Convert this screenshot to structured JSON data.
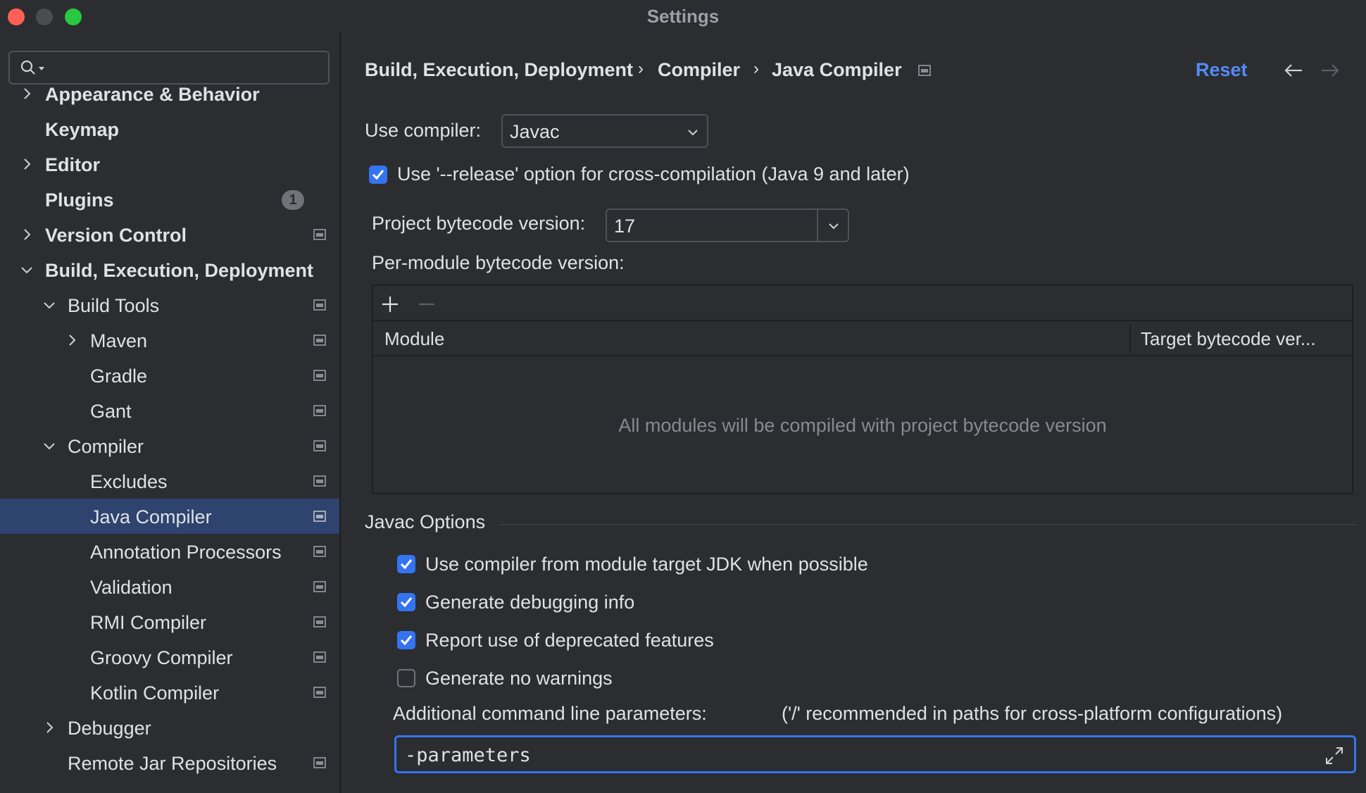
{
  "window": {
    "title": "Settings"
  },
  "search": {
    "placeholder": "",
    "value": ""
  },
  "sidebar": {
    "items": [
      {
        "label": "Appearance & Behavior",
        "bold": true
      },
      {
        "label": "Keymap",
        "bold": true
      },
      {
        "label": "Editor",
        "bold": true
      },
      {
        "label": "Plugins",
        "bold": true,
        "badge": "1"
      },
      {
        "label": "Version Control",
        "bold": true
      },
      {
        "label": "Build, Execution, Deployment",
        "bold": true,
        "expanded": true
      },
      {
        "label": "Build Tools",
        "expanded": true
      },
      {
        "label": "Maven"
      },
      {
        "label": "Gradle"
      },
      {
        "label": "Gant"
      },
      {
        "label": "Compiler",
        "expanded": true
      },
      {
        "label": "Excludes"
      },
      {
        "label": "Java Compiler",
        "selected": true
      },
      {
        "label": "Annotation Processors"
      },
      {
        "label": "Validation"
      },
      {
        "label": "RMI Compiler"
      },
      {
        "label": "Groovy Compiler"
      },
      {
        "label": "Kotlin Compiler"
      },
      {
        "label": "Debugger"
      },
      {
        "label": "Remote Jar Repositories"
      }
    ]
  },
  "header": {
    "breadcrumb": [
      "Build, Execution, Deployment",
      "Compiler",
      "Java Compiler"
    ],
    "separator": "›",
    "reset_label": "Reset"
  },
  "form": {
    "use_compiler_label": "Use compiler:",
    "use_compiler_value": "Javac",
    "release_option_label": "Use '--release' option for cross-compilation (Java 9 and later)",
    "release_option_checked": true,
    "bytecode_label": "Project bytecode version:",
    "bytecode_value": "17",
    "per_module_label": "Per-module bytecode version:"
  },
  "table": {
    "columns": [
      "Module",
      "Target bytecode ver..."
    ],
    "empty_text": "All modules will be compiled with project bytecode version"
  },
  "javac": {
    "section_title": "Javac Options",
    "options": [
      {
        "label": "Use compiler from module target JDK when possible",
        "checked": true
      },
      {
        "label": "Generate debugging info",
        "checked": true
      },
      {
        "label": "Report use of deprecated features",
        "checked": true
      },
      {
        "label": "Generate no warnings",
        "checked": false
      }
    ],
    "additional_label": "Additional command line parameters:",
    "additional_hint": "('/' recommended in paths for cross-platform configurations)",
    "additional_value": "-parameters"
  },
  "colors": {
    "accent": "#3574f0",
    "link": "#548af7",
    "selection": "#2e436e",
    "background": "#2b2d30"
  }
}
